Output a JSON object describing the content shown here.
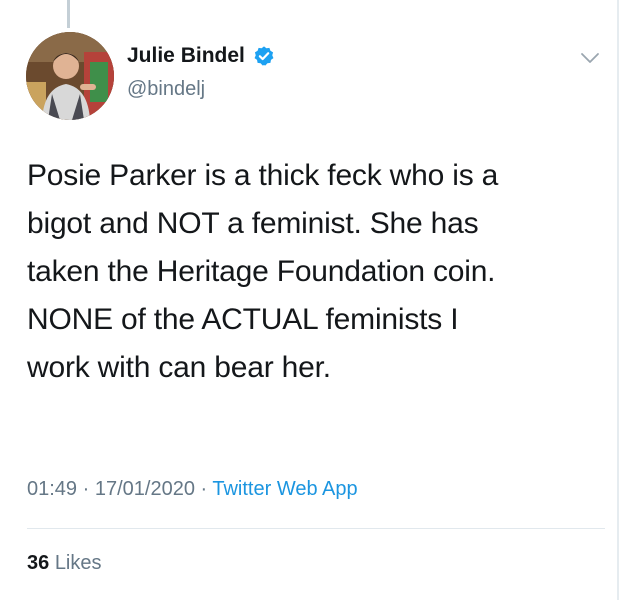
{
  "account": {
    "display_name": "Julie Bindel",
    "handle": "@bindelj",
    "verified_icon": "verified-badge-icon",
    "avatar_alt": "avatar"
  },
  "menu": {
    "icon": "chevron-down-icon"
  },
  "tweet": {
    "lines": [
      "Posie Parker is a thick feck who is a",
      "bigot and NOT a feminist. She has",
      "taken the Heritage Foundation coin.",
      "NONE of the ACTUAL feminists I",
      "work with can bear her."
    ]
  },
  "meta": {
    "time": "01:49",
    "separator": " · ",
    "date": "17/01/2020",
    "source": "Twitter Web App"
  },
  "engagement": {
    "likes_count": "36",
    "likes_label": "Likes"
  },
  "colors": {
    "link_blue": "#1b95e0",
    "text_primary": "#14171a",
    "text_secondary": "#657786",
    "verified_blue": "#1da1f2"
  }
}
